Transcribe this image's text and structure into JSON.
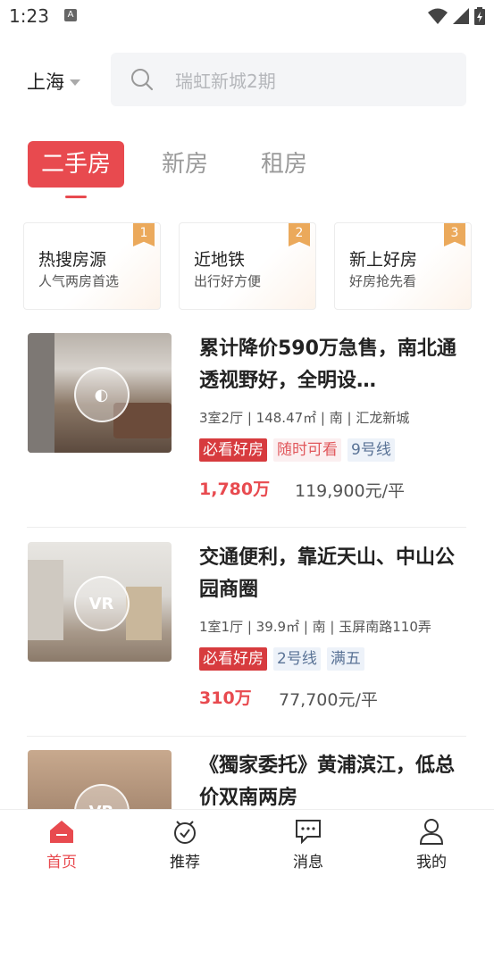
{
  "status": {
    "time": "1:23",
    "notification_glyph": "A"
  },
  "header": {
    "city": "上海",
    "search_placeholder": "瑞虹新城2期"
  },
  "tabs": [
    {
      "label": "二手房",
      "active": true
    },
    {
      "label": "新房",
      "active": false
    },
    {
      "label": "租房",
      "active": false
    }
  ],
  "quick_cards": [
    {
      "title": "热搜房源",
      "subtitle": "人气两房首选",
      "rank": "1"
    },
    {
      "title": "近地铁",
      "subtitle": "出行好方便",
      "rank": "2"
    },
    {
      "title": "新上好房",
      "subtitle": "好房抢先看",
      "rank": "3"
    }
  ],
  "listings": [
    {
      "title": "累计降价590万急售，南北通透视野好，全明设…",
      "info": "3室2厅 | 148.47㎡ | 南 | 汇龙新城",
      "tags": [
        "必看好房",
        "随时可看",
        "9号线"
      ],
      "price": "1,780万",
      "unit_price": "119,900元/平"
    },
    {
      "title": "交通便利，靠近天山、中山公园商圈",
      "info": "1室1厅 | 39.9㎡ | 南 | 玉屏南路110弄",
      "tags": [
        "必看好房",
        "2号线",
        "满五"
      ],
      "price": "310万",
      "unit_price": "77,700元/平"
    },
    {
      "title": "《獨家委托》黄浦滨江，低总价双南两房",
      "info": "",
      "tags": [],
      "price": "",
      "unit_price": ""
    }
  ],
  "bottom_nav": [
    {
      "label": "首页",
      "icon": "home-icon",
      "active": true
    },
    {
      "label": "推荐",
      "icon": "recommend-icon",
      "active": false
    },
    {
      "label": "消息",
      "icon": "message-icon",
      "active": false
    },
    {
      "label": "我的",
      "icon": "profile-icon",
      "active": false
    }
  ],
  "colors": {
    "accent": "#e84a4f",
    "badge": "#eba95b"
  }
}
